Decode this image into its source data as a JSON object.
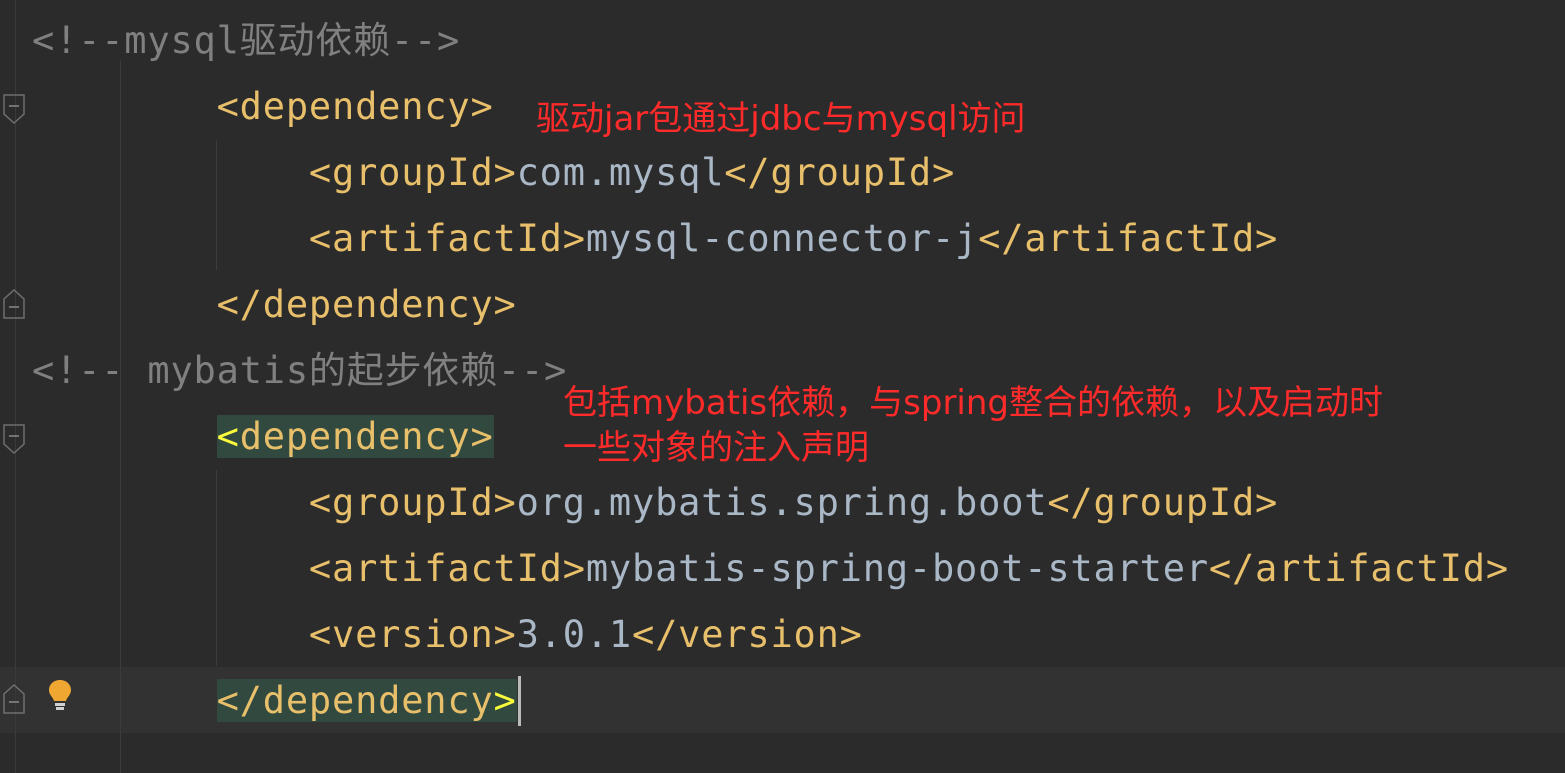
{
  "editor": {
    "lines": [
      {
        "indent": "",
        "parts": [
          {
            "t": "<!--mysql驱动依赖-->",
            "c": "cmt"
          }
        ]
      },
      {
        "indent": "        ",
        "parts": [
          {
            "t": "<dependency>",
            "c": "tag"
          }
        ]
      },
      {
        "indent": "            ",
        "parts": [
          {
            "t": "<groupId>",
            "c": "tag"
          },
          {
            "t": "com.mysql",
            "c": "txt"
          },
          {
            "t": "</groupId>",
            "c": "tag"
          }
        ]
      },
      {
        "indent": "            ",
        "parts": [
          {
            "t": "<artifactId>",
            "c": "tag"
          },
          {
            "t": "mysql-connector-j",
            "c": "txt"
          },
          {
            "t": "</artifactId>",
            "c": "tag"
          }
        ]
      },
      {
        "indent": "        ",
        "parts": [
          {
            "t": "</dependency>",
            "c": "tag"
          }
        ]
      },
      {
        "indent": "",
        "parts": [
          {
            "t": "<!-- mybatis的起步依赖-->",
            "c": "cmt"
          }
        ]
      },
      {
        "indent": "        ",
        "parts": [
          {
            "t": "<",
            "c": "match"
          },
          {
            "t": "dependency>",
            "c": "tag"
          }
        ],
        "highlight": true
      },
      {
        "indent": "            ",
        "parts": [
          {
            "t": "<groupId>",
            "c": "tag"
          },
          {
            "t": "org.mybatis.spring.boot",
            "c": "txt"
          },
          {
            "t": "</groupId>",
            "c": "tag"
          }
        ]
      },
      {
        "indent": "            ",
        "parts": [
          {
            "t": "<artifactId>",
            "c": "tag"
          },
          {
            "t": "mybatis-spring-boot-starter",
            "c": "txt"
          },
          {
            "t": "</artifactId>",
            "c": "tag"
          }
        ]
      },
      {
        "indent": "            ",
        "parts": [
          {
            "t": "<version>",
            "c": "tag"
          },
          {
            "t": "3.0.1",
            "c": "txt"
          },
          {
            "t": "</version>",
            "c": "tag"
          }
        ]
      },
      {
        "indent": "        ",
        "parts": [
          {
            "t": "</dependency",
            "c": "tag"
          },
          {
            "t": ">",
            "c": "match"
          }
        ],
        "highlight": true,
        "caret": true
      }
    ]
  },
  "annotations": {
    "note1": "驱动jar包通过jdbc与mysql访问",
    "note2_line1": "包括mybatis依赖，与spring整合的依赖，以及启动时",
    "note2_line2": "一些对象的注入声明"
  },
  "colors": {
    "background": "#2b2b2b",
    "tag": "#e8bf6a",
    "text": "#a9b7c6",
    "comment": "#808080",
    "annotation": "#ff2a2a",
    "match_highlight": "#32493f"
  },
  "icons": [
    "fold-marker-icon",
    "lightbulb-icon"
  ]
}
